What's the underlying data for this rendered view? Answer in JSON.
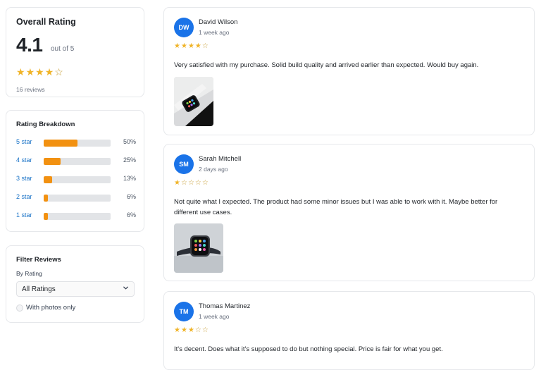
{
  "overall": {
    "title": "Overall Rating",
    "rating": "4.1",
    "out_of": "out of 5",
    "stars": 4,
    "review_count": "16 reviews"
  },
  "breakdown": {
    "title": "Rating Breakdown",
    "rows": [
      {
        "label": "5 star",
        "percent": 50,
        "percent_text": "50%"
      },
      {
        "label": "4 star",
        "percent": 25,
        "percent_text": "25%"
      },
      {
        "label": "3 star",
        "percent": 13,
        "percent_text": "13%"
      },
      {
        "label": "2 star",
        "percent": 6,
        "percent_text": "6%"
      },
      {
        "label": "1 star",
        "percent": 6,
        "percent_text": "6%"
      }
    ]
  },
  "filter": {
    "title": "Filter Reviews",
    "by_rating_label": "By Rating",
    "selected_rating": "All Ratings",
    "photos_only_label": "With photos only",
    "photos_only_checked": false
  },
  "reviews": [
    {
      "initials": "DW",
      "name": "David Wilson",
      "time": "1 week ago",
      "stars": 4,
      "text": "Very satisfied with my purchase. Solid build quality and arrived earlier than expected. Would buy again.",
      "has_photo": true
    },
    {
      "initials": "SM",
      "name": "Sarah Mitchell",
      "time": "2 days ago",
      "stars": 1,
      "text": "Not quite what I expected. The product had some minor issues but I was able to work with it. Maybe better for different use cases.",
      "has_photo": true
    },
    {
      "initials": "TM",
      "name": "Thomas Martinez",
      "time": "1 week ago",
      "stars": 3,
      "text": "It's decent. Does what it's supposed to do but nothing special. Price is fair for what you get.",
      "has_photo": false
    }
  ],
  "colors": {
    "accent": "#1a73e8",
    "bar_fill": "#f29111",
    "star": "#f0b429",
    "link": "#1a73c7"
  },
  "icons": {
    "star_full": "★",
    "star_empty": "☆",
    "chevron_down": "⌄"
  }
}
